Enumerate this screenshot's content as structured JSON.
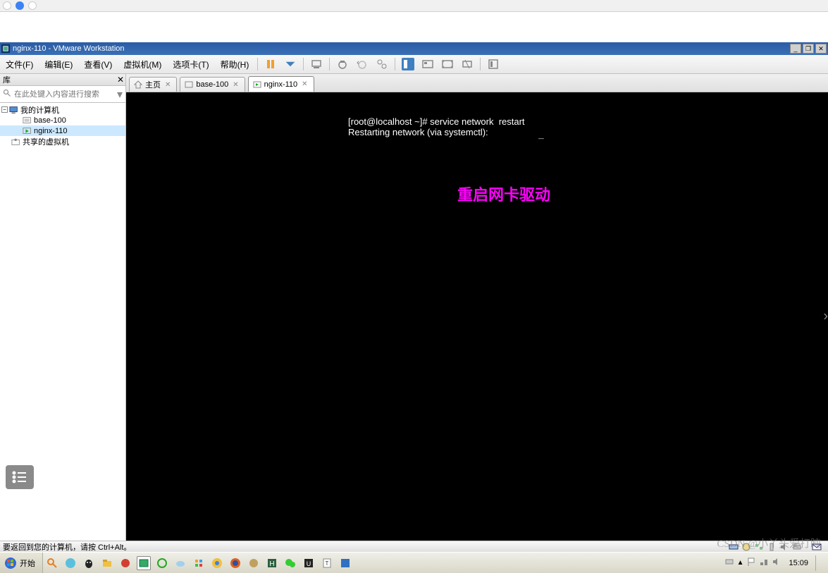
{
  "browser_top": {
    "circles": [
      "#ffffff",
      "#3b82f6",
      "#ffffff"
    ]
  },
  "titlebar": {
    "title": "nginx-110 - VMware Workstation",
    "buttons": [
      "_",
      "❐",
      "✕"
    ]
  },
  "menu": {
    "items": [
      "文件(F)",
      "编辑(E)",
      "查看(V)",
      "虚拟机(M)",
      "选项卡(T)",
      "帮助(H)"
    ]
  },
  "sidebar": {
    "title": "库",
    "search_placeholder": "在此处键入内容进行搜索",
    "tree": {
      "root": "我的计算机",
      "items": [
        "base-100",
        "nginx-110"
      ],
      "selected_index": 1,
      "shared": "共享的虚拟机"
    }
  },
  "tabs": [
    {
      "label": "主页",
      "icon": "home",
      "active": false
    },
    {
      "label": "base-100",
      "icon": "vm",
      "active": false
    },
    {
      "label": "nginx-110",
      "icon": "vm",
      "active": true
    }
  ],
  "console": {
    "line1": "[root@localhost ~]# service network  restart",
    "line2": "Restarting network (via systemctl):  ",
    "cursor": "_"
  },
  "annotation": "重启网卡驱动",
  "statusbar": {
    "text": "要返回到您的计算机，请按 Ctrl+Alt。"
  },
  "taskbar": {
    "start": "开始",
    "clock": "15:09"
  },
  "watermark": "CSDN @小丫头爱打盹"
}
